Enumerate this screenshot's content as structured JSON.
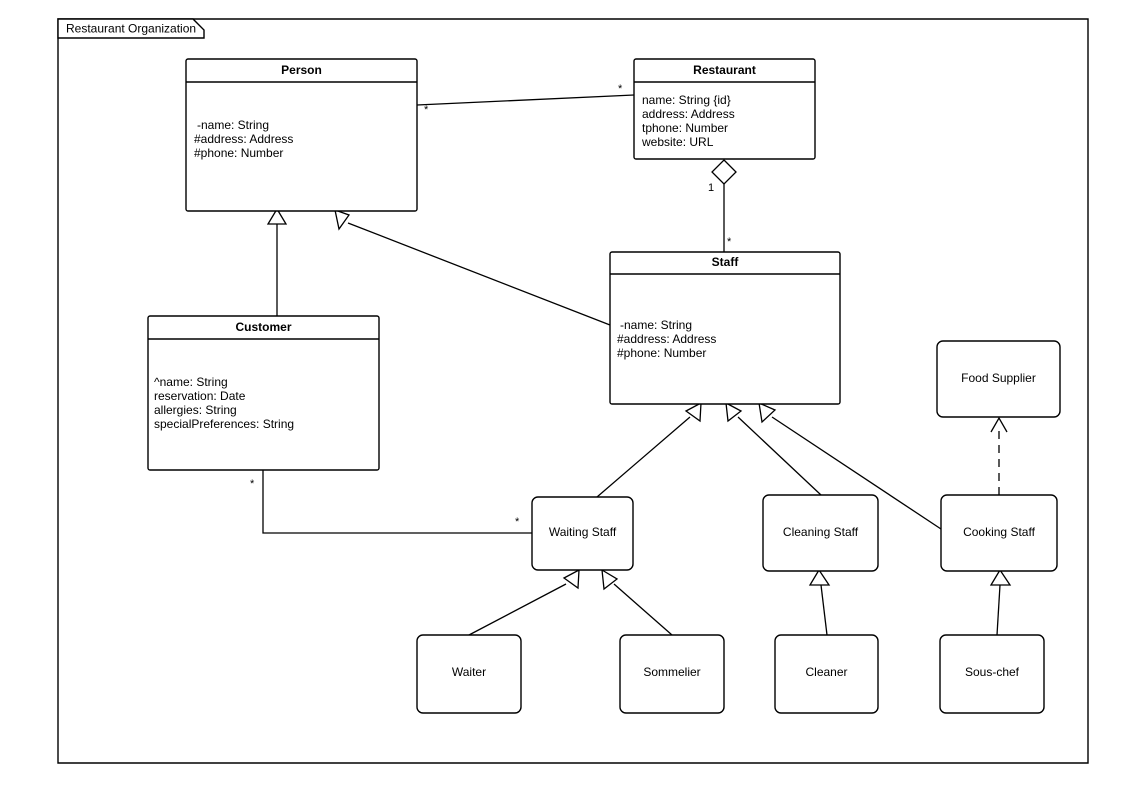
{
  "frame": {
    "label": "Restaurant Organization"
  },
  "classes": {
    "person": {
      "name": "Person",
      "attributes": [
        "-name: String",
        "#address: Address",
        "#phone: Number"
      ]
    },
    "restaurant": {
      "name": "Restaurant",
      "attributes": [
        "name: String {id}",
        "address: Address",
        "tphone: Number",
        "website: URL"
      ]
    },
    "customer": {
      "name": "Customer",
      "attributes": [
        "^name: String",
        "reservation: Date",
        "allergies: String",
        "specialPreferences: String"
      ]
    },
    "staff": {
      "name": "Staff",
      "attributes": [
        "-name: String",
        "#address: Address",
        "#phone: Number"
      ]
    },
    "food_supplier": {
      "name": "Food Supplier"
    },
    "waiting_staff": {
      "name": "Waiting Staff"
    },
    "cleaning_staff": {
      "name": "Cleaning Staff"
    },
    "cooking_staff": {
      "name": "Cooking Staff"
    },
    "waiter": {
      "name": "Waiter"
    },
    "sommelier": {
      "name": "Sommelier"
    },
    "cleaner": {
      "name": "Cleaner"
    },
    "sous_chef": {
      "name": "Sous-chef"
    }
  },
  "multiplicities": {
    "person_restaurant_person_end": "*",
    "person_restaurant_restaurant_end": "*",
    "restaurant_staff_aggregate_end": "1",
    "restaurant_staff_staff_end": "*",
    "customer_waiting_customer_end": "*",
    "customer_waiting_waiting_end": "*"
  },
  "colors": {
    "stroke": "#000000",
    "fill": "#ffffff",
    "background": "#ffffff"
  }
}
